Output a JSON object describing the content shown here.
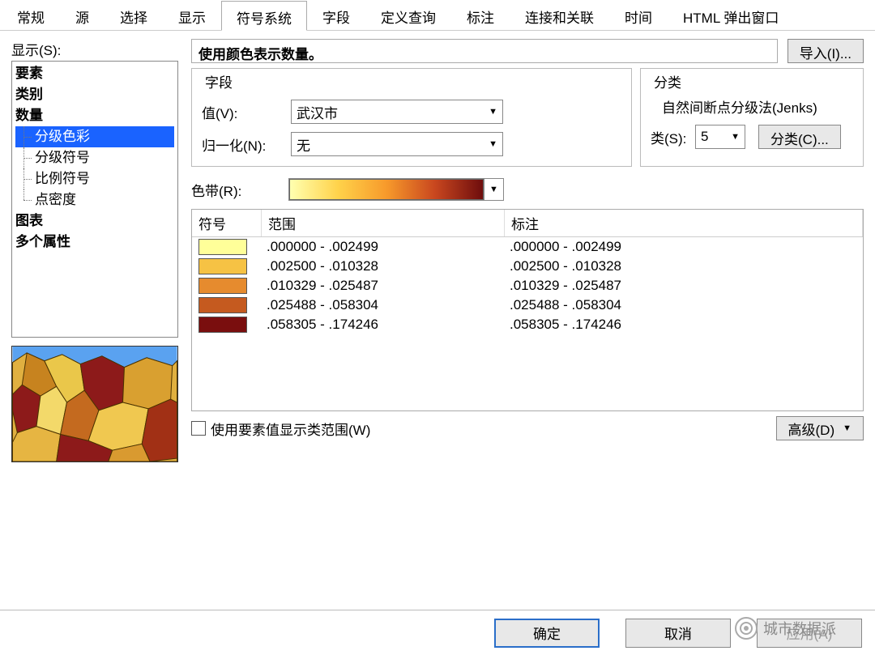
{
  "tabs": [
    "常规",
    "源",
    "选择",
    "显示",
    "符号系统",
    "字段",
    "定义查询",
    "标注",
    "连接和关联",
    "时间",
    "HTML 弹出窗口"
  ],
  "activeTab": 4,
  "leftPanel": {
    "showLabel": "显示(S):",
    "items": [
      "要素",
      "类别",
      "数量"
    ],
    "subItems": [
      "分级色彩",
      "分级符号",
      "比例符号",
      "点密度"
    ],
    "selectedSub": 0,
    "extra": [
      "图表",
      "多个属性"
    ]
  },
  "header": {
    "title": "使用颜色表示数量。",
    "importBtn": "导入(I)..."
  },
  "fieldSection": {
    "title": "字段",
    "valueLabel": "值(V):",
    "valueSelected": "武汉市",
    "normLabel": "归一化(N):",
    "normSelected": "无"
  },
  "classSection": {
    "title": "分类",
    "method": "自然间断点分级法(Jenks)",
    "classesLabel": "类(S):",
    "classesValue": "5",
    "classifyBtn": "分类(C)..."
  },
  "rampLabel": "色带(R):",
  "tableHead": {
    "sym": "符号",
    "range": "范围",
    "label": "标注"
  },
  "rows": [
    {
      "color": "#ffff99",
      "range": ".000000 - .002499",
      "label": ".000000 - .002499"
    },
    {
      "color": "#f6c244",
      "range": ".002500 - .010328",
      "label": ".002500 - .010328"
    },
    {
      "color": "#e68b2e",
      "range": ".010329 - .025487",
      "label": ".010329 - .025487"
    },
    {
      "color": "#c55a1f",
      "range": ".025488 - .058304",
      "label": ".025488 - .058304"
    },
    {
      "color": "#7a0e0e",
      "range": ".058305 - .174246",
      "label": ".058305 - .174246"
    }
  ],
  "checkboxLabel": "使用要素值显示类范围(W)",
  "advancedBtn": "高级(D)",
  "buttons": {
    "ok": "确定",
    "cancel": "取消",
    "apply": "应用(A)"
  },
  "watermark": "城市数据派"
}
